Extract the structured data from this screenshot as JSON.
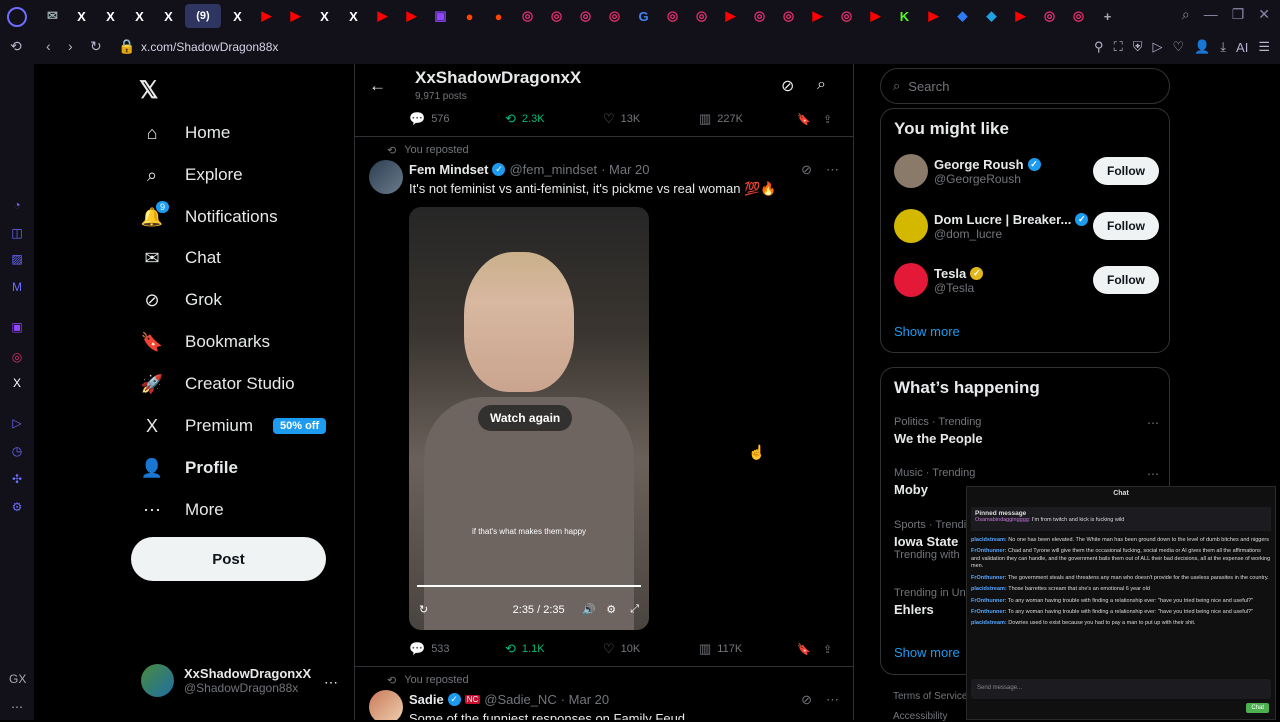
{
  "browser": {
    "active_tab_label": "(9)",
    "url": "x.com/ShadowDragon88x",
    "ai_label": "AI",
    "tabs": [
      {
        "glyph": "✉",
        "color": "#9aa"
      },
      {
        "glyph": "X",
        "color": "#fff"
      },
      {
        "glyph": "X",
        "color": "#fff"
      },
      {
        "glyph": "X",
        "color": "#fff"
      },
      {
        "glyph": "X",
        "color": "#fff"
      },
      {
        "glyph": "X",
        "color": "#fff"
      },
      {
        "glyph": "▶",
        "color": "#ff0000"
      },
      {
        "glyph": "▶",
        "color": "#ff0000"
      },
      {
        "glyph": "X",
        "color": "#fff"
      },
      {
        "glyph": "X",
        "color": "#fff"
      },
      {
        "glyph": "▶",
        "color": "#ff0000"
      },
      {
        "glyph": "▶",
        "color": "#ff0000"
      },
      {
        "glyph": "▣",
        "color": "#9146ff"
      },
      {
        "glyph": "●",
        "color": "#ff4500"
      },
      {
        "glyph": "●",
        "color": "#ff4500"
      },
      {
        "glyph": "◎",
        "color": "#e1306c"
      },
      {
        "glyph": "◎",
        "color": "#e1306c"
      },
      {
        "glyph": "◎",
        "color": "#e1306c"
      },
      {
        "glyph": "◎",
        "color": "#e1306c"
      },
      {
        "glyph": "G",
        "color": "#4285f4"
      },
      {
        "glyph": "◎",
        "color": "#e1306c"
      },
      {
        "glyph": "◎",
        "color": "#e1306c"
      },
      {
        "glyph": "▶",
        "color": "#ff0000"
      },
      {
        "glyph": "◎",
        "color": "#e1306c"
      },
      {
        "glyph": "◎",
        "color": "#e1306c"
      },
      {
        "glyph": "▶",
        "color": "#ff0000"
      },
      {
        "glyph": "◎",
        "color": "#e1306c"
      },
      {
        "glyph": "▶",
        "color": "#ff0000"
      },
      {
        "glyph": "K",
        "color": "#53fc18"
      },
      {
        "glyph": "▶",
        "color": "#ff0000"
      },
      {
        "glyph": "◆",
        "color": "#2e7bf6"
      },
      {
        "glyph": "◆",
        "color": "#1fa0e0"
      },
      {
        "glyph": "▶",
        "color": "#ff0000"
      },
      {
        "glyph": "◎",
        "color": "#e1306c"
      },
      {
        "glyph": "◎",
        "color": "#e1306c"
      },
      {
        "glyph": "+",
        "color": "#aaa"
      }
    ]
  },
  "nav": {
    "items": [
      {
        "label": "Home",
        "icon": "⌂",
        "name": "home"
      },
      {
        "label": "Explore",
        "icon": "⌕",
        "name": "explore"
      },
      {
        "label": "Notifications",
        "icon": "🔔",
        "name": "notifications",
        "badge": "9"
      },
      {
        "label": "Chat",
        "icon": "✉",
        "name": "chat"
      },
      {
        "label": "Grok",
        "icon": "⊘",
        "name": "grok"
      },
      {
        "label": "Bookmarks",
        "icon": "🔖",
        "name": "bookmarks"
      },
      {
        "label": "Creator Studio",
        "icon": "🚀",
        "name": "creator-studio"
      },
      {
        "label": "Premium",
        "icon": "X",
        "name": "premium",
        "promo": "50% off"
      },
      {
        "label": "Profile",
        "icon": "👤",
        "name": "profile",
        "bold": true
      },
      {
        "label": "More",
        "icon": "⋯",
        "name": "more"
      }
    ],
    "post_label": "Post",
    "account": {
      "name": "XxShadowDragonxX",
      "handle": "@ShadowDragon88x"
    }
  },
  "profile_header": {
    "title": "XxShadowDragonxX",
    "posts": "9,971 posts"
  },
  "top_actions": {
    "replies": "576",
    "reposts": "2.3K",
    "likes": "13K",
    "views": "227K"
  },
  "tweet1": {
    "repost_label": "You reposted",
    "name": "Fem Mindset",
    "handle": "@fem_mindset",
    "date": "· Mar 20",
    "text": "It's not feminist vs anti-feminist, it's pickme vs real woman 💯🔥",
    "video": {
      "overlay": "Watch again",
      "caption": "if that's what makes them happy",
      "time": "2:35 / 2:35"
    },
    "replies": "533",
    "reposts": "1.1K",
    "likes": "10K",
    "views": "117K"
  },
  "tweet2": {
    "repost_label": "You reposted",
    "name": "Sadie",
    "handle": "@Sadie_NC",
    "date": "· Mar 20",
    "text": "Some of the funniest responses on Family Feud"
  },
  "right": {
    "search_placeholder": "Search",
    "wtf_title": "You might like",
    "suggestions": [
      {
        "name": "George Roush",
        "handle": "@GeorgeRoush",
        "verified": "blue",
        "color": "#8a7a6a"
      },
      {
        "name": "Dom Lucre | Breaker...",
        "handle": "@dom_lucre",
        "verified": "blue",
        "color": "#d4b800"
      },
      {
        "name": "Tesla",
        "handle": "@Tesla",
        "verified": "gold",
        "color": "#e31937"
      }
    ],
    "follow_label": "Follow",
    "show_more": "Show more",
    "happening_title": "What’s happening",
    "trends": [
      {
        "meta": "Politics · Trending",
        "title": "We the People"
      },
      {
        "meta": "Music · Trending",
        "title": "Moby"
      },
      {
        "meta": "Sports · Trendi",
        "title": "Iowa State",
        "extra": "Trending with"
      },
      {
        "meta": "Trending in Uni",
        "title": "Ehlers"
      }
    ],
    "show_more2": "Show more",
    "footer": [
      "Terms of Service",
      "Accessibility"
    ]
  },
  "chat": {
    "title": "Chat",
    "pinned_label": "Pinned message",
    "pinned_user": "Osamabindaggingggg:",
    "pinned_text": "I'm from twitch and kick is fucking wild",
    "messages": [
      {
        "user": "placidstream:",
        "text": "No one has been elevated. The White man has been ground down to the level of dumb bitches and niggers",
        "color": "#58a6ff"
      },
      {
        "user": "FrOnthunner:",
        "text": "Chad and Tyrone will give them the occasional fucking, social media or AI gives them all the affirmations and validation they can handle, and the government bails them out of ALL their bad decisions, all at the expense of working men.",
        "color": "#58a6ff"
      },
      {
        "user": "FrOnthunner:",
        "text": "The government steals and threatens any man who doesn't provide for the useless parasites in the country.",
        "color": "#58a6ff"
      },
      {
        "user": "placidstream:",
        "text": "Those barrettes scream that she's an emotional 6 year old",
        "color": "#58a6ff"
      },
      {
        "user": "FrOnthunner:",
        "text": "To any woman having trouble with finding a relationship ever: \"have you tried being nice and useful?\"",
        "color": "#58a6ff"
      },
      {
        "user": "FrOnthunner:",
        "text": "To any woman having trouble with finding a relationship ever: \"have you tried being nice and useful?\"",
        "color": "#58a6ff"
      },
      {
        "user": "placidstream:",
        "text": "Dowries used to exist because you had to pay a man to put up with their shit.",
        "color": "#58a6ff"
      }
    ],
    "input_placeholder": "Send message...",
    "send_label": "Chat"
  }
}
